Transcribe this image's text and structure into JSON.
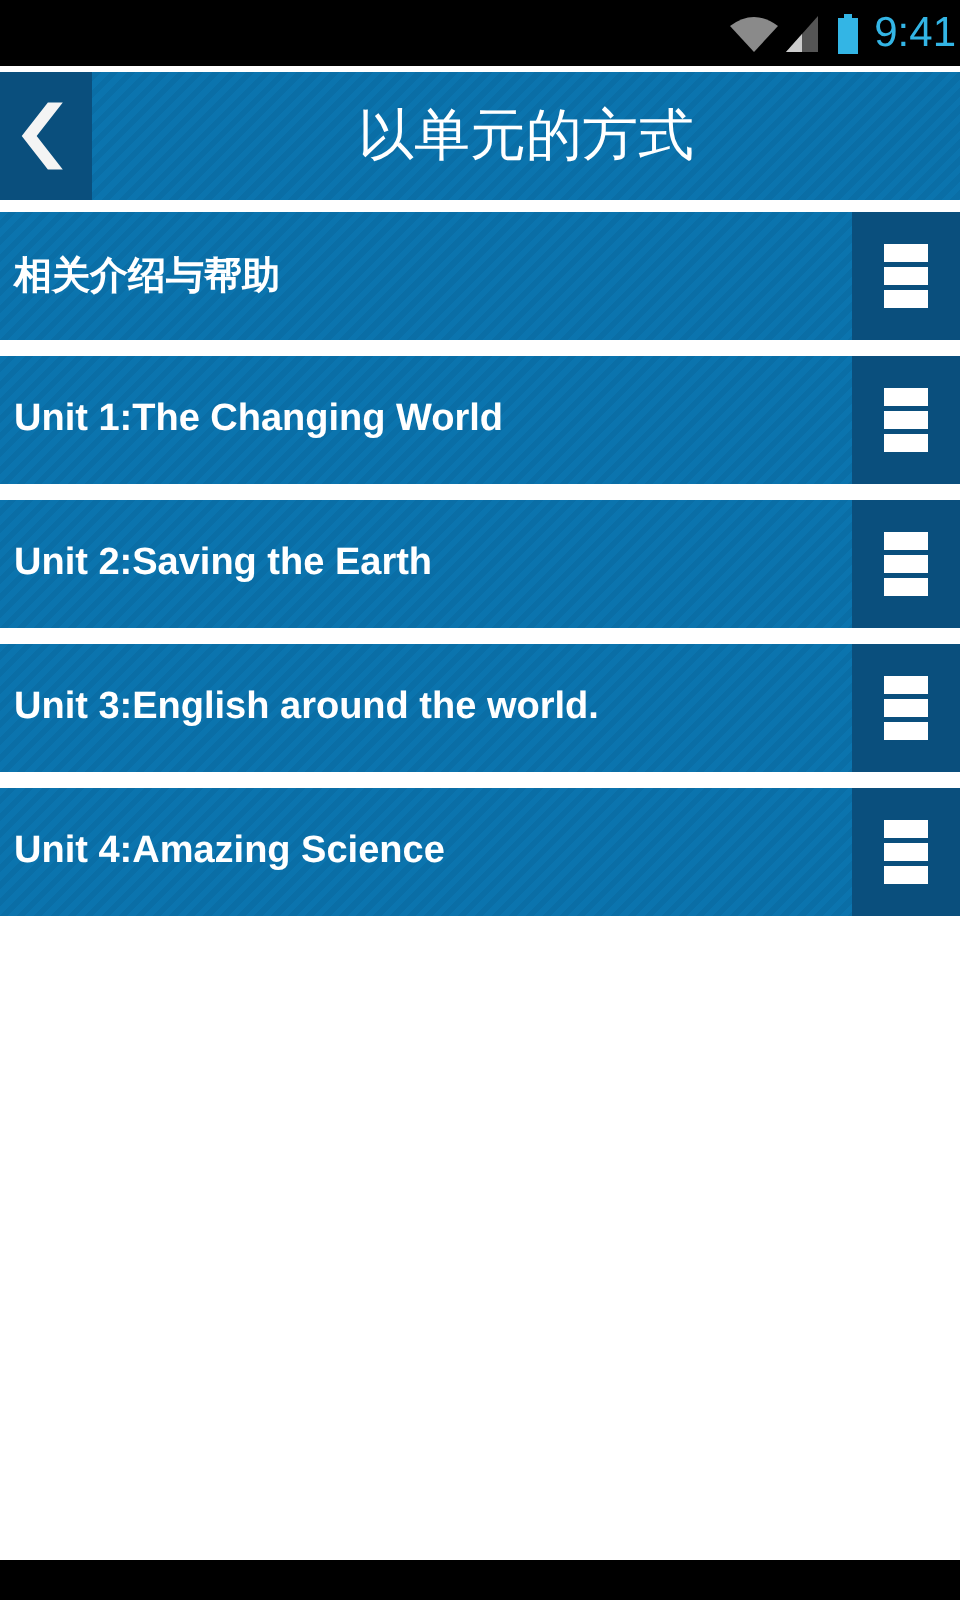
{
  "status_bar": {
    "time": "9:41"
  },
  "header": {
    "title": "以单元的方式"
  },
  "items": [
    {
      "label": "相关介绍与帮助"
    },
    {
      "label": "Unit 1:The Changing World"
    },
    {
      "label": "Unit 2:Saving the Earth"
    },
    {
      "label": "Unit 3:English around the world."
    },
    {
      "label": "Unit 4:Amazing Science"
    }
  ]
}
